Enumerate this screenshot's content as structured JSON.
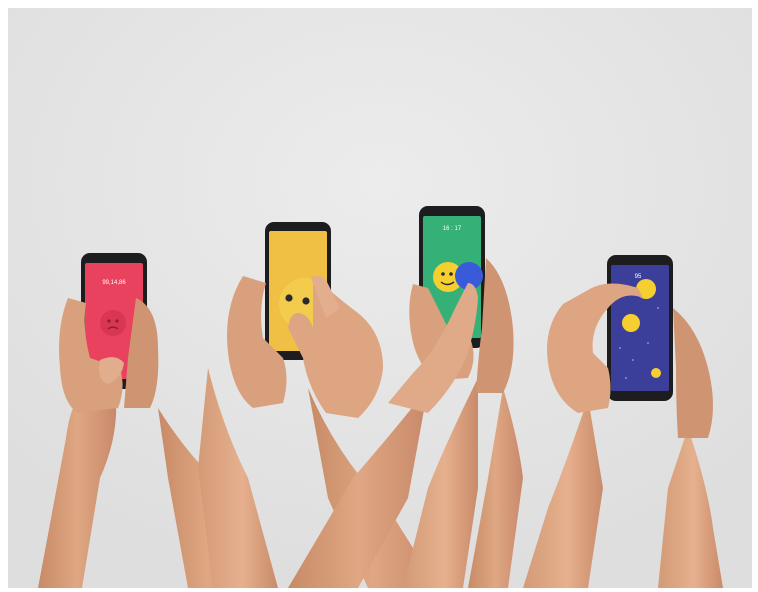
{
  "image": {
    "background": "#e4e4e4",
    "phones": [
      {
        "screen_color": "#e8425f",
        "status_text": "99,14,86",
        "emoji": "sad-face"
      },
      {
        "screen_color": "#efc044",
        "status_text": "",
        "emoji": "smiley-face"
      },
      {
        "screen_color": "#35b178",
        "status_text": "16 : 17",
        "emoji": "two-faces"
      },
      {
        "screen_color": "#3b3f9a",
        "status_text": "95",
        "emoji": "floating-faces"
      }
    ],
    "colors": {
      "skin": "#d9a07e",
      "skin_shadow": "#c0855f",
      "phone_body": "#1d1d1f",
      "emoji_yellow": "#f5cf2f"
    }
  }
}
